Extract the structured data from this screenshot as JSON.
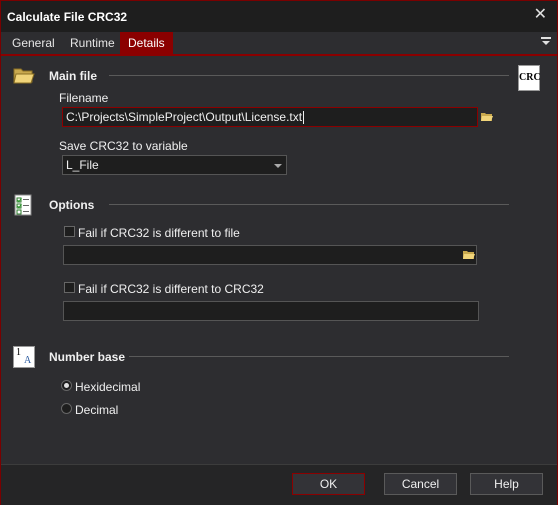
{
  "window": {
    "title": "Calculate File CRC32"
  },
  "tabs": [
    {
      "label": "General"
    },
    {
      "label": "Runtime"
    },
    {
      "label": "Details"
    }
  ],
  "main_file": {
    "heading": "Main file",
    "filename_label": "Filename",
    "filename_value": "C:\\Projects\\SimpleProject\\Output\\License.txt",
    "variable_label": "Save CRC32 to variable",
    "variable_value": "L_File",
    "badge": "CRC"
  },
  "options": {
    "heading": "Options",
    "fail_file_label": "Fail if CRC32 is different to file",
    "fail_file_checked": false,
    "fail_file_value": "",
    "fail_crc_label": "Fail if CRC32 is different to CRC32",
    "fail_crc_checked": false,
    "fail_crc_value": ""
  },
  "number_base": {
    "heading": "Number base",
    "options": [
      {
        "label": "Hexidecimal",
        "selected": true
      },
      {
        "label": "Decimal",
        "selected": false
      }
    ]
  },
  "buttons": {
    "ok": "OK",
    "cancel": "Cancel",
    "help": "Help"
  },
  "colors": {
    "accent": "#8b0000",
    "background": "#2d2d30",
    "field": "#1e1e1e"
  }
}
